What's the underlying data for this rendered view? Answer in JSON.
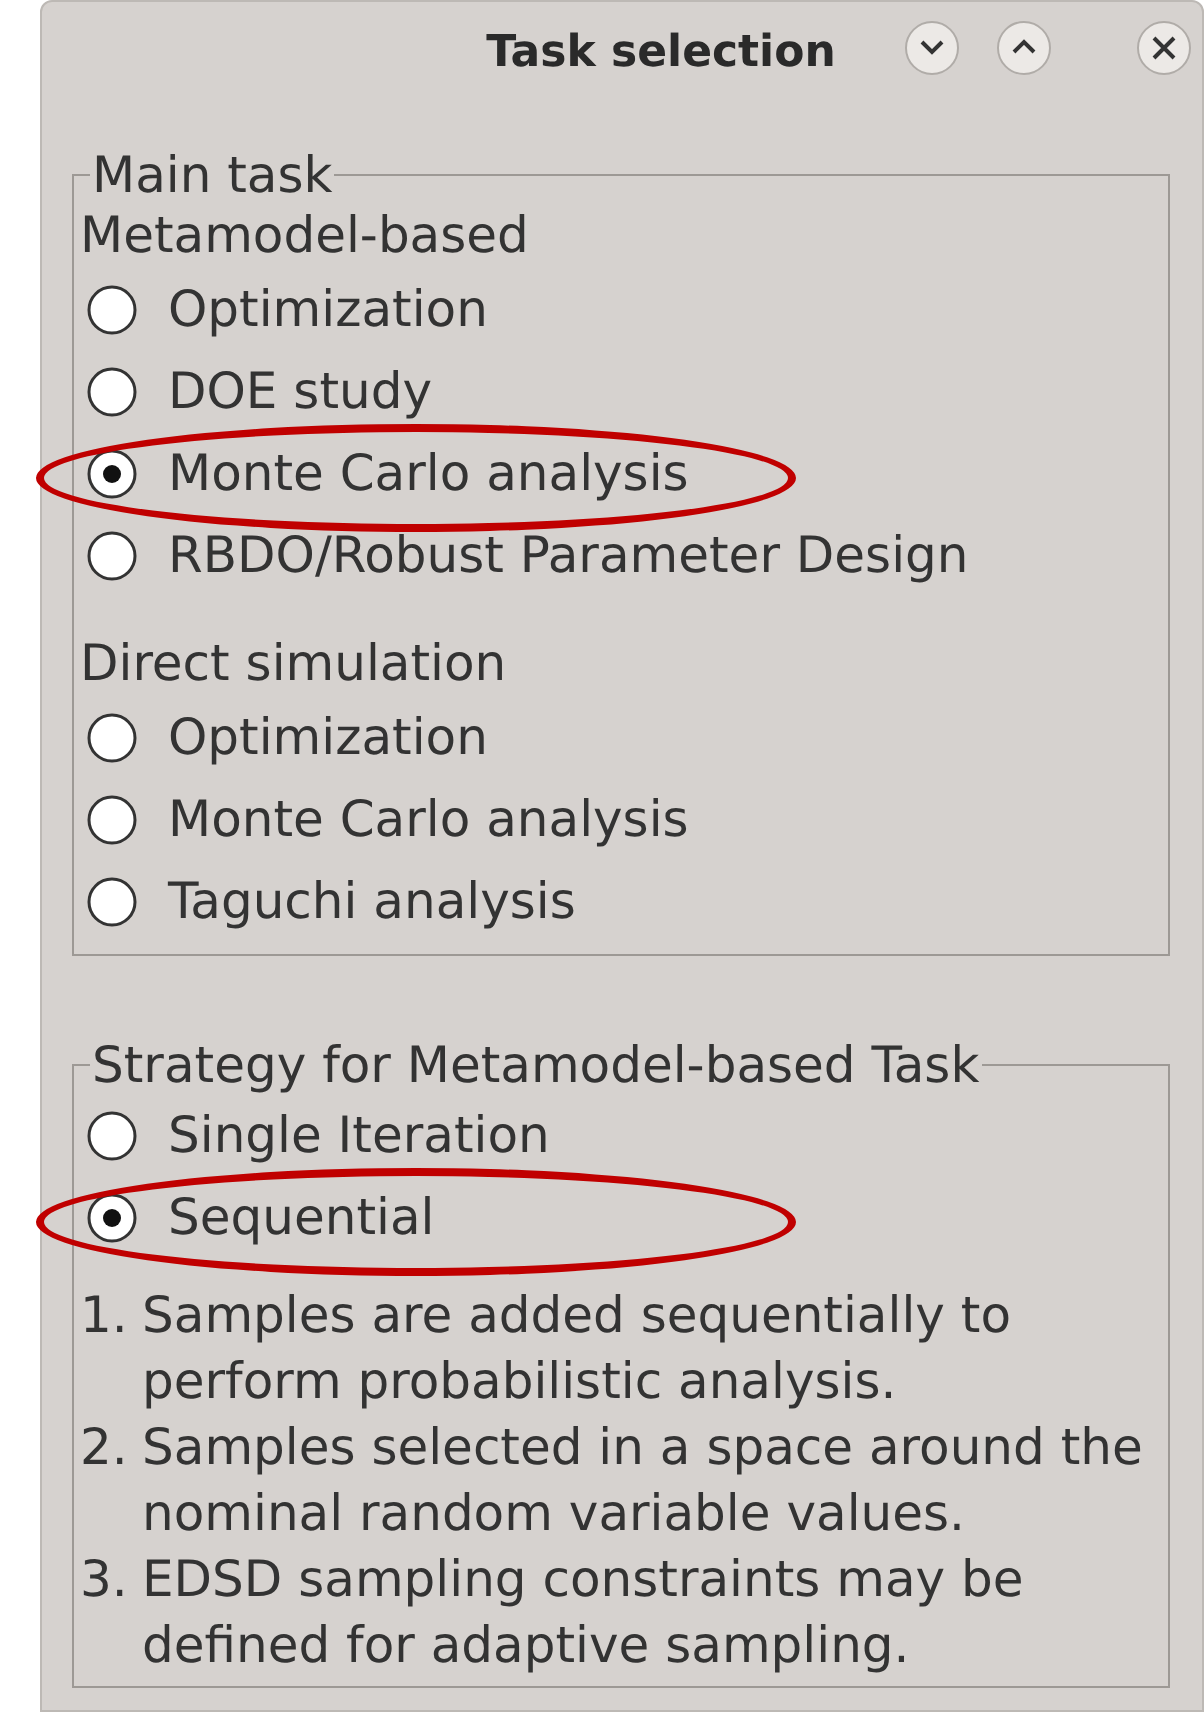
{
  "window": {
    "title": "Task selection"
  },
  "main_task": {
    "title": "Main task",
    "sections": [
      {
        "heading": "Metamodel-based",
        "options": [
          {
            "label": "Optimization",
            "selected": false,
            "highlighted": false
          },
          {
            "label": "DOE study",
            "selected": false,
            "highlighted": false
          },
          {
            "label": "Monte Carlo analysis",
            "selected": true,
            "highlighted": true
          },
          {
            "label": "RBDO/Robust Parameter Design",
            "selected": false,
            "highlighted": false
          }
        ]
      },
      {
        "heading": "Direct simulation",
        "options": [
          {
            "label": "Optimization",
            "selected": false,
            "highlighted": false
          },
          {
            "label": "Monte Carlo analysis",
            "selected": false,
            "highlighted": false
          },
          {
            "label": "Taguchi analysis",
            "selected": false,
            "highlighted": false
          }
        ]
      }
    ]
  },
  "strategy": {
    "title": "Strategy for Metamodel-based Task",
    "options": [
      {
        "label": "Single Iteration",
        "selected": false,
        "highlighted": false
      },
      {
        "label": "Sequential",
        "selected": true,
        "highlighted": true
      }
    ],
    "notes": [
      {
        "number": "1.",
        "text": "Samples are added sequentially to perform probabilistic analysis."
      },
      {
        "number": "2.",
        "text": "Samples selected in a space around the nominal random variable values."
      },
      {
        "number": "3.",
        "text": "EDSD sampling constraints may be defined for adaptive sampling."
      }
    ]
  }
}
